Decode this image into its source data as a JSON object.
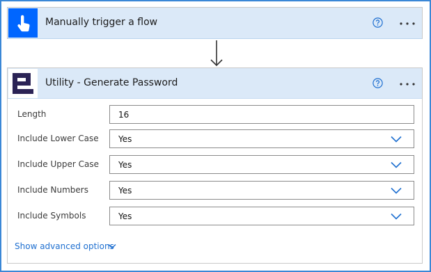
{
  "trigger": {
    "title": "Manually trigger a flow",
    "icon": "touch-hand-icon",
    "icon_color": "#0066ff"
  },
  "action": {
    "title": "Utility - Generate Password",
    "icon": "utility-logo-icon",
    "icon_color": "#2b2355"
  },
  "fields": [
    {
      "label": "Length",
      "value": "16",
      "type": "text"
    },
    {
      "label": "Include Lower Case",
      "value": "Yes",
      "type": "dropdown"
    },
    {
      "label": "Include Upper Case",
      "value": "Yes",
      "type": "dropdown"
    },
    {
      "label": "Include Numbers",
      "value": "Yes",
      "type": "dropdown"
    },
    {
      "label": "Include Symbols",
      "value": "Yes",
      "type": "dropdown"
    }
  ],
  "advanced_options_label": "Show advanced options",
  "colors": {
    "header_bg": "#dbe9f8",
    "accent": "#1e6fd0",
    "frame_border": "#3a87d6"
  }
}
